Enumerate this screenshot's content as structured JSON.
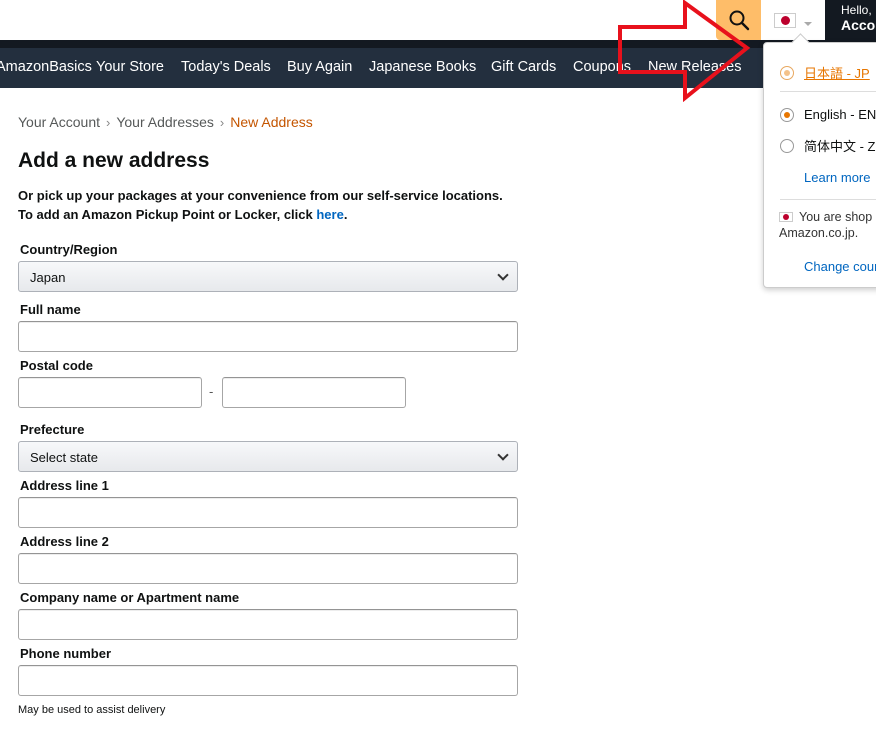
{
  "header": {
    "account_hello": "Hello,",
    "account_label": "Acco",
    "icons": {
      "search": "search-icon",
      "flag": "japan-flag-icon"
    },
    "colors": {
      "search_bg": "#febd69",
      "nav_bg": "#232f3e",
      "top_bg": "#131921"
    }
  },
  "nav": {
    "items": [
      "AmazonBasics",
      "Your Store",
      "Today's Deals",
      "Buy Again",
      "Japanese Books",
      "Gift Cards",
      "Coupons",
      "New Releases"
    ]
  },
  "breadcrumb": {
    "items": [
      "Your Account",
      "Your Addresses"
    ],
    "current": "New Address"
  },
  "form": {
    "title": "Add a new address",
    "intro_line1": "Or pick up your packages at your convenience from our self-service locations.",
    "intro_line2_prefix": "To add an Amazon Pickup Point or Locker, click",
    "intro_link": "here",
    "country_label": "Country/Region",
    "country_value": "Japan",
    "fullname_label": "Full name",
    "postal_label": "Postal code",
    "postal_dash": "-",
    "prefecture_label": "Prefecture",
    "prefecture_value": "Select state",
    "address1_label": "Address line 1",
    "address2_label": "Address line 2",
    "company_label": "Company name or Apartment name",
    "phone_label": "Phone number",
    "phone_hint": "May be used to assist delivery"
  },
  "language_dropdown": {
    "options": [
      {
        "label": "日本語 - JP",
        "selected": false
      },
      {
        "label": "English - EN",
        "selected": true
      },
      {
        "label": "简体中文 - ZH",
        "selected": false
      }
    ],
    "learn_more": "Learn more",
    "shop_line1": "You are shop",
    "shop_line2": "Amazon.co.jp.",
    "change_country": "Change cour"
  }
}
